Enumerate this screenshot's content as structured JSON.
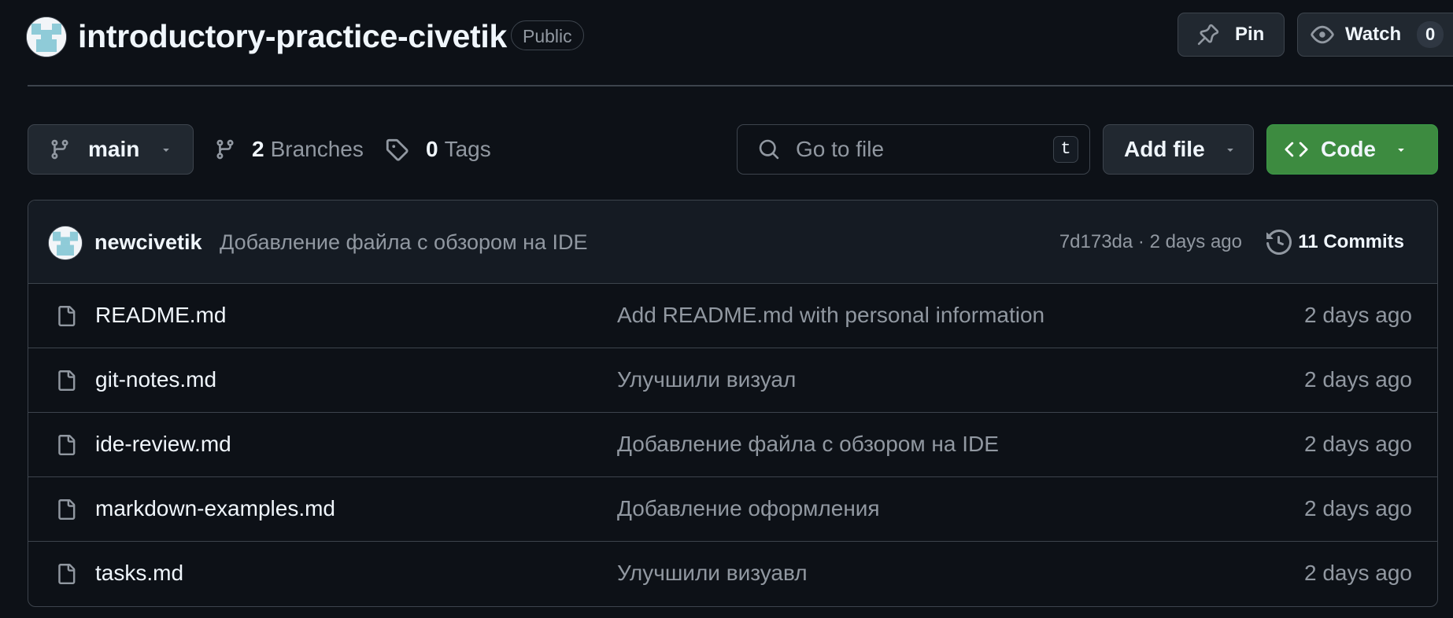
{
  "repo": {
    "name": "introductory-practice-civetik",
    "visibility": "Public",
    "avatar": "identicon-avatar"
  },
  "actions": {
    "pin_label": "Pin",
    "watch_label": "Watch",
    "watch_count": "0"
  },
  "toolbar": {
    "branch": "main",
    "branches_count": "2",
    "branches_label": "Branches",
    "tags_count": "0",
    "tags_label": "Tags",
    "search_placeholder": "Go to file",
    "search_shortcut": "t",
    "add_file_label": "Add file",
    "code_label": "Code"
  },
  "latest_commit": {
    "author": "newcivetik",
    "message": "Добавление файла с обзором на IDE",
    "sha": "7d173da",
    "time": "2 days ago",
    "meta": "7d173da · 2 days ago",
    "commits_label": "11 Commits"
  },
  "files": [
    {
      "name": "README.md",
      "message": "Add README.md with personal information",
      "date": "2 days ago"
    },
    {
      "name": "git-notes.md",
      "message": "Улучшили визуал",
      "date": "2 days ago"
    },
    {
      "name": "ide-review.md",
      "message": "Добавление файла с обзором на IDE",
      "date": "2 days ago"
    },
    {
      "name": "markdown-examples.md",
      "message": "Добавление оформления",
      "date": "2 days ago"
    },
    {
      "name": "tasks.md",
      "message": "Улучшили визуавл",
      "date": "2 days ago"
    }
  ],
  "colors": {
    "background": "#0d1117",
    "border": "#3d444d",
    "muted_text": "#9198a1",
    "primary_button": "#3d8b40"
  },
  "icons": [
    "pin-icon",
    "eye-icon",
    "git-branch-icon",
    "tag-icon",
    "search-icon",
    "code-icon",
    "history-icon",
    "file-icon",
    "caret-down-icon"
  ]
}
